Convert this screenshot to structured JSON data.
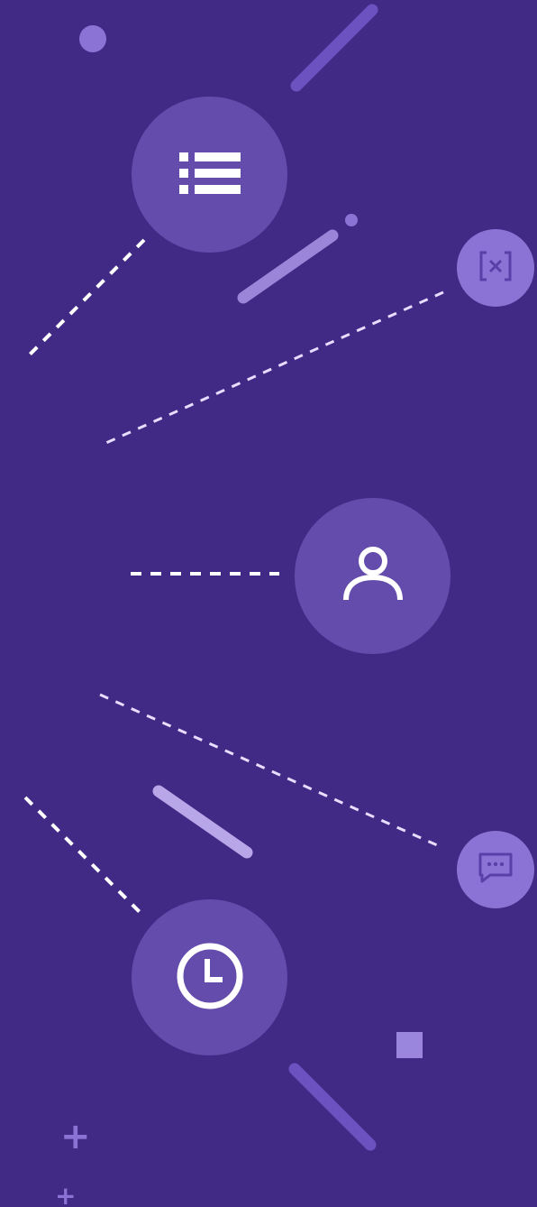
{
  "colors": {
    "background": "#412a85",
    "hub_fill": "#644cad",
    "node_fill": "#8b73d6",
    "accent_light": "#b7a6e8",
    "icon_white": "#ffffff",
    "icon_dim": "#5b3fa8"
  },
  "hubs": [
    {
      "icon": "list-icon"
    },
    {
      "icon": "user-icon"
    },
    {
      "icon": "clock-icon"
    }
  ],
  "nodes": [
    {
      "icon": "variable-bracket-icon"
    },
    {
      "icon": "chat-bubble-icon"
    }
  ],
  "decorations": {
    "plus_glyph": "+"
  }
}
